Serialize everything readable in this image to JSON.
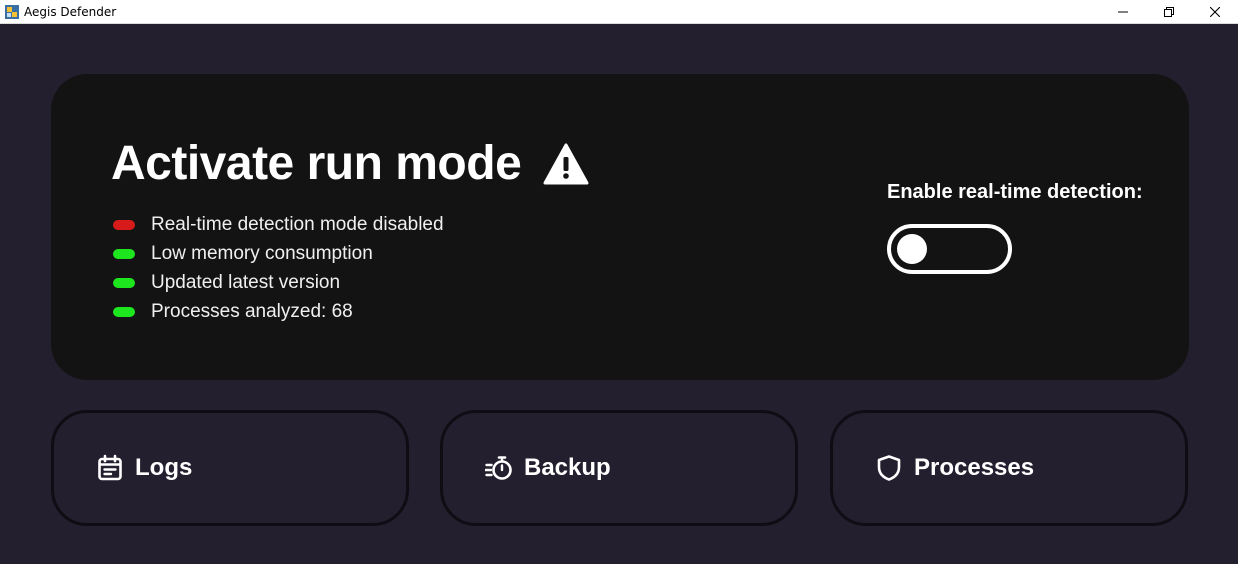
{
  "window": {
    "title": "Aegis Defender",
    "icon": "shield-app-icon",
    "controls": [
      "minimize",
      "maximize",
      "close"
    ]
  },
  "status_card": {
    "headline": "Activate run mode",
    "headline_icon": "warning-icon",
    "items": [
      {
        "label": "Real-time detection mode disabled",
        "state": "error",
        "color": "#d71b1b"
      },
      {
        "label": "Low memory consumption",
        "state": "ok",
        "color": "#1ee61e"
      },
      {
        "label": "Updated latest version",
        "state": "ok",
        "color": "#1ee61e"
      },
      {
        "label": "Processes analyzed: 68",
        "state": "ok",
        "color": "#1ee61e"
      }
    ],
    "toggle_label": "Enable real-time detection:",
    "toggle_on": false
  },
  "nav": [
    {
      "label": "Logs",
      "icon": "calendar-list-icon"
    },
    {
      "label": "Backup",
      "icon": "stopwatch-fast-icon"
    },
    {
      "label": "Processes",
      "icon": "shield-outline-icon"
    }
  ],
  "colors": {
    "background": "#231f2e",
    "card": "#131313",
    "text": "#ffffff",
    "ok": "#1ee61e",
    "error": "#d71b1b"
  }
}
